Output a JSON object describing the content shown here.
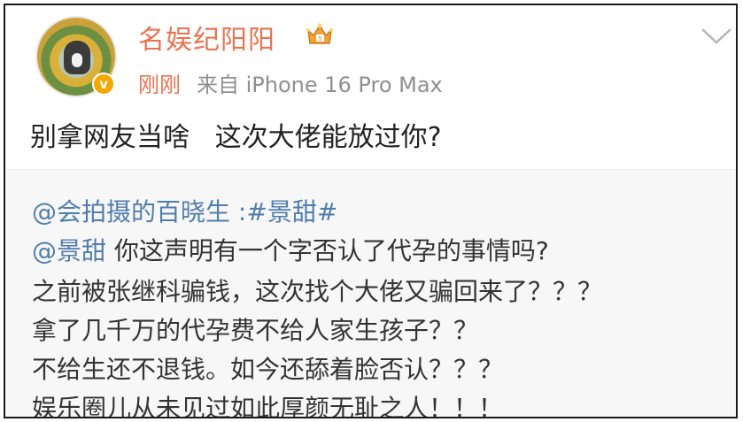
{
  "post": {
    "username": "名娱纪阳阳",
    "time": "刚刚",
    "source": "来自 iPhone 16 Pro Max",
    "text": "别拿网友当啥   这次大佬能放过你?",
    "icons": {
      "avatar": "user-avatar",
      "verified": "verified-badge-icon",
      "vip": "crown-icon",
      "menu": "chevron-down-icon"
    }
  },
  "repost": {
    "author_mention": "@会拍摄的百晓生",
    "author_separator": ":",
    "hashtag": "#景甜#",
    "line2_mention": "@景甜",
    "line2_text": " 你这声明有一个字否认了代孕的事情吗?",
    "line3": "之前被张继科骗钱，这次找个大佬又骗回来了？？？",
    "line4": "拿了几千万的代孕费不给人家生孩子？？",
    "line5": "不给生还不退钱。如今还舔着脸否认？？？",
    "line6": "娱乐圈儿从未见过如此厚颜无耻之人！！！"
  },
  "colors": {
    "username": "#eb7350",
    "mention": "#507daf",
    "repost_bg": "#f7f7f7",
    "meta_gray": "#8f8f8f"
  }
}
